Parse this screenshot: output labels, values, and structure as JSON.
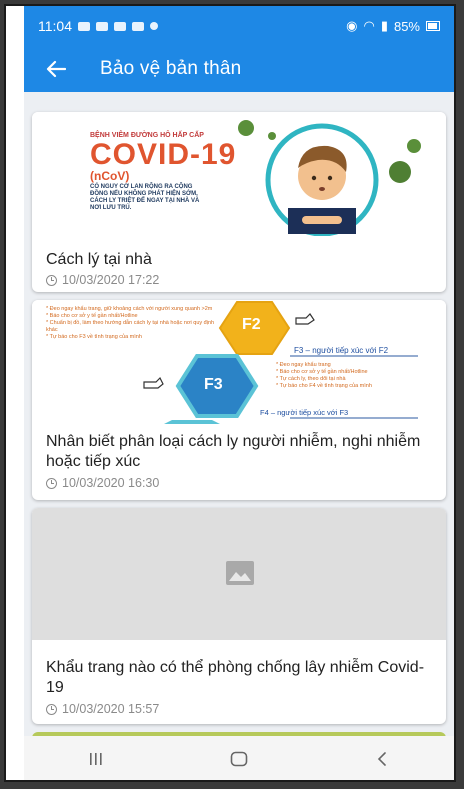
{
  "status_bar": {
    "time": "11:04",
    "battery": "85%"
  },
  "app_bar": {
    "title": "Bảo vệ bản thân",
    "back_icon": "arrow-left-icon"
  },
  "colors": {
    "primary": "#1e88e5",
    "background": "#eceff3",
    "meta_text": "#8a8a8a"
  },
  "articles": [
    {
      "title": "Cách lý tại nhà",
      "date": "10/03/2020 17:22",
      "image": {
        "header": "BỆNH VIÊM ĐƯỜNG HÔ HẤP CẤP",
        "headline": "COVID-19",
        "subline": "(nCoV)",
        "note": "CÓ NGUY CƠ LAN RỘNG RA CỘNG ĐỒNG NẾU KHÔNG PHÁT HIỆN SỚM, CÁCH LY TRIỆT ĐỂ NGAY TẠI NHÀ VÀ NƠI LƯU TRÚ."
      }
    },
    {
      "title": "Nhân biết phân loại cách ly người nhiễm, nghi nhiễm hoặc tiếp xúc",
      "date": "10/03/2020 16:30",
      "image": {
        "f2": "F2",
        "f3": "F3",
        "f3_caption": "F3 – người tiếp xúc với F2",
        "f4_caption": "F4 – người tiếp xúc với F3",
        "f3_notes": [
          "* Đeo ngay khẩu trang",
          "* Báo cho cơ sở y tế gần nhất/Hotline",
          "* Tự cách ly, theo dõi tại nhà",
          "* Tự báo cho F4 về tình trạng của mình"
        ],
        "f2_notes": [
          "* Đeo ngay khẩu trang, giữ khoảng cách với người xung quanh >2m",
          "* Báo cho cơ sở y tế gần nhất/Hotline",
          "* Chuẩn bị đồ, làm theo hướng dẫn cách ly tại nhà hoặc nơi quy định khác",
          "* Tự báo cho F3 về tình trạng của mình"
        ]
      }
    },
    {
      "title": "Khẩu trang nào có thể phòng chống lây nhiễm Covid-19",
      "date": "10/03/2020 15:57"
    }
  ]
}
